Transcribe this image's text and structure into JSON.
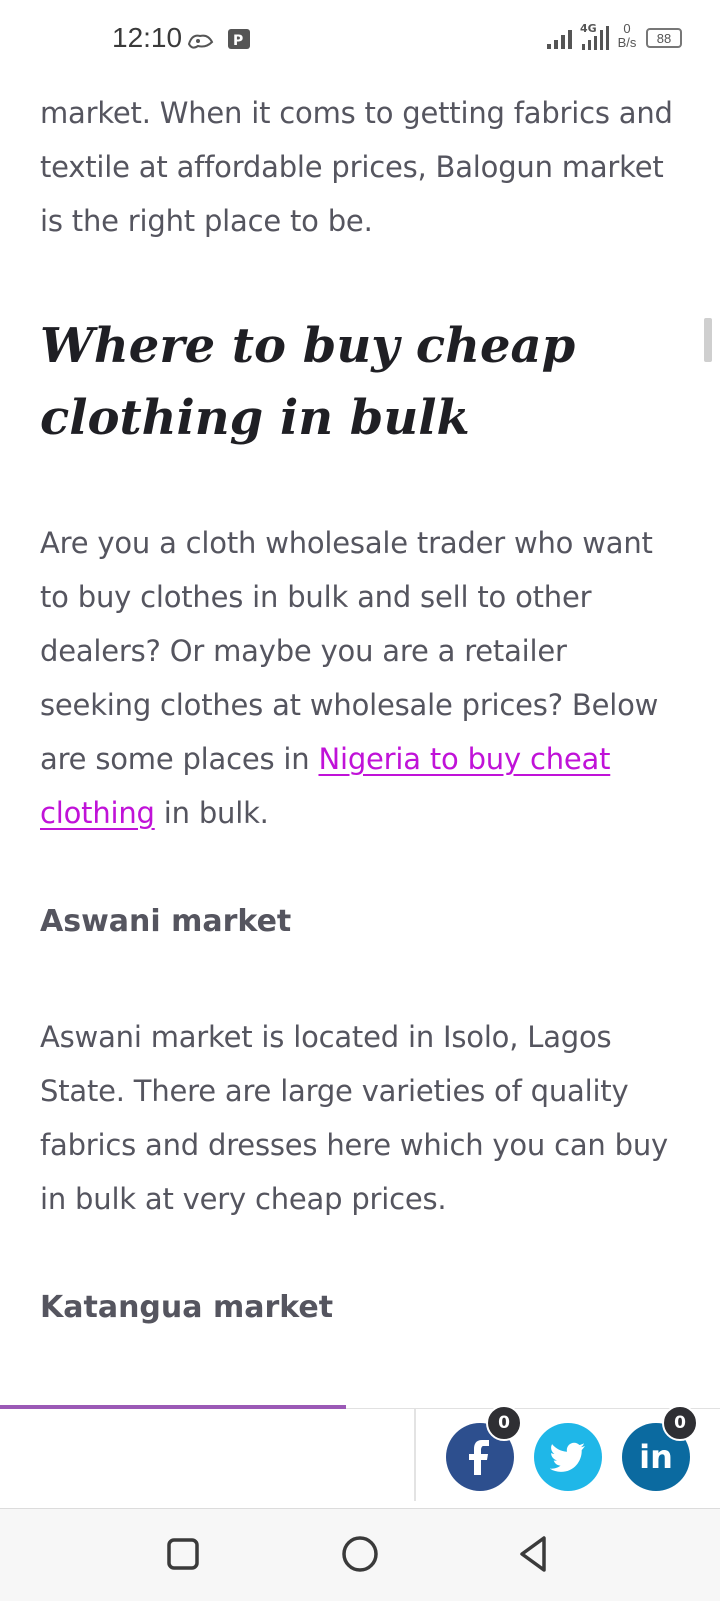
{
  "status_bar": {
    "time": "12:10",
    "network_label": "4G",
    "data_speed_value": "0",
    "data_speed_unit": "B/s",
    "battery": "88"
  },
  "article": {
    "paragraph_intro": "market. When it coms to getting fabrics and textile at affordable prices, Balogun market is the right place to be.",
    "heading": "Where to buy cheap clothing in bulk",
    "paragraph_main_before_link": "Are you a cloth wholesale trader who want to buy clothes in bulk and sell to other dealers? Or maybe you are a retailer seeking clothes at wholesale prices? Below are some places in ",
    "paragraph_main_link": "Nigeria to buy cheat clothing",
    "paragraph_main_after_link": " in bulk.",
    "section_1_title": "Aswani market",
    "section_1_text": "Aswani market is located in Isolo, Lagos State. There are large varieties of quality fabrics and dresses here which you can buy in bulk at very cheap prices.",
    "section_2_title": "Katangua market"
  },
  "share_bar": {
    "reading_progress": 0.48,
    "facebook": {
      "icon": "facebook-icon",
      "count": "0",
      "color": "#2d4f8e"
    },
    "twitter": {
      "icon": "twitter-icon",
      "color": "#1fb7e8"
    },
    "linkedin": {
      "icon": "linkedin-icon",
      "count": "0",
      "color": "#0b6aa0"
    }
  },
  "nav_bar": {
    "buttons": [
      "recent-apps-icon",
      "home-icon",
      "back-icon"
    ]
  }
}
